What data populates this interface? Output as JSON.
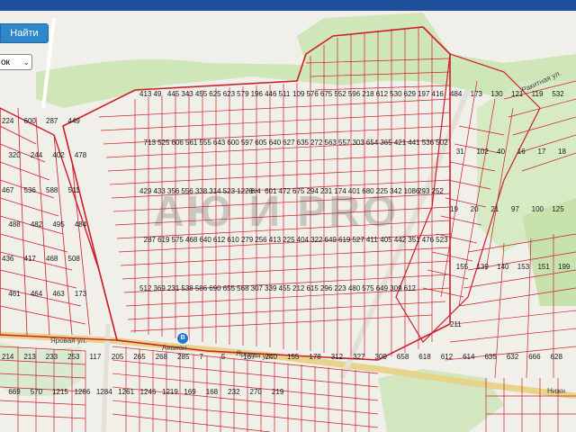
{
  "toolbar": {
    "find_button_label": "Найти",
    "layer_select_value": "ок"
  },
  "map": {
    "watermark_text": "АЮ И PRO",
    "stop_label": "Ананон",
    "streets": [
      "Яровая ул.",
      "Яровая ул.",
      "Нижн",
      "Ракитная ул."
    ],
    "parcel_numbers": [
      "413",
      "49",
      "445",
      "343",
      "455",
      "625",
      "623",
      "579",
      "196",
      "446",
      "511",
      "109",
      "576",
      "675",
      "552",
      "596",
      "218",
      "612",
      "530",
      "629",
      "197",
      "416",
      "713",
      "525",
      "606",
      "561",
      "555",
      "643",
      "600",
      "597",
      "605",
      "640",
      "627",
      "635",
      "272",
      "563",
      "557",
      "303",
      "654",
      "365",
      "421",
      "441",
      "536",
      "502",
      "429",
      "433",
      "356",
      "556",
      "338",
      "314",
      "523",
      "1228",
      "8/4",
      "601",
      "472",
      "675",
      "294",
      "231",
      "174",
      "401",
      "680",
      "225",
      "342",
      "1086",
      "293",
      "252",
      "287",
      "619",
      "575",
      "468",
      "640",
      "612",
      "610",
      "279",
      "256",
      "413",
      "225",
      "404",
      "322",
      "649",
      "619",
      "527",
      "411",
      "405",
      "442",
      "351",
      "476",
      "523",
      "512",
      "369",
      "231",
      "538",
      "586",
      "690",
      "655",
      "568",
      "307",
      "339",
      "455",
      "212",
      "615",
      "296",
      "223",
      "480",
      "575",
      "649",
      "309",
      "612",
      "224",
      "600",
      "287",
      "449",
      "320",
      "244",
      "402",
      "478",
      "467",
      "536",
      "588",
      "511",
      "488",
      "482",
      "495",
      "484",
      "436",
      "417",
      "468",
      "508",
      "461",
      "464",
      "463",
      "173",
      "484",
      "173",
      "130",
      "121",
      "119",
      "532",
      "31",
      "102",
      "40",
      "16",
      "17",
      "18",
      "19",
      "20",
      "21",
      "97",
      "100",
      "125",
      "155",
      "139",
      "140",
      "153",
      "151",
      "199",
      "211",
      "214",
      "213",
      "233",
      "253",
      "117",
      "205",
      "265",
      "268",
      "285",
      "7",
      "5",
      "167",
      "240",
      "155",
      "178",
      "312",
      "327",
      "309",
      "658",
      "618",
      "612",
      "614",
      "635",
      "632",
      "666",
      "628",
      "669",
      "570",
      "1215",
      "1286",
      "1284",
      "1261",
      "1246",
      "1219",
      "169",
      "168",
      "232",
      "270",
      "219"
    ]
  }
}
